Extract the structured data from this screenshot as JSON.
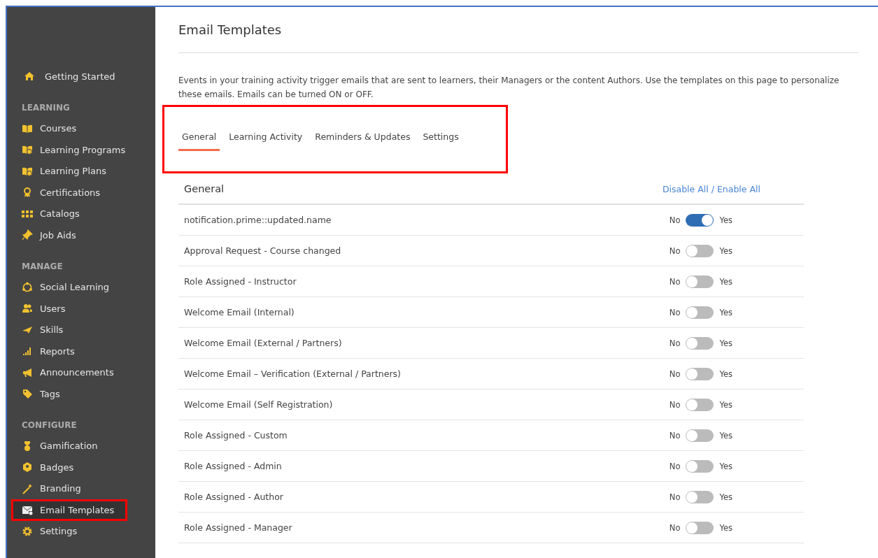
{
  "sidebar": {
    "top_items": [
      {
        "label": "Getting Started",
        "selected": false
      }
    ],
    "sections": [
      {
        "title": "LEARNING",
        "items": [
          {
            "label": "Courses",
            "selected": false
          },
          {
            "label": "Learning Programs",
            "selected": false
          },
          {
            "label": "Learning Plans",
            "selected": false
          },
          {
            "label": "Certifications",
            "selected": false
          },
          {
            "label": "Catalogs",
            "selected": false
          },
          {
            "label": "Job Aids",
            "selected": false
          }
        ]
      },
      {
        "title": "MANAGE",
        "items": [
          {
            "label": "Social Learning",
            "selected": false
          },
          {
            "label": "Users",
            "selected": false
          },
          {
            "label": "Skills",
            "selected": false
          },
          {
            "label": "Reports",
            "selected": false
          },
          {
            "label": "Announcements",
            "selected": false
          },
          {
            "label": "Tags",
            "selected": false
          }
        ]
      },
      {
        "title": "CONFIGURE",
        "items": [
          {
            "label": "Gamification",
            "selected": false
          },
          {
            "label": "Badges",
            "selected": false
          },
          {
            "label": "Branding",
            "selected": false
          },
          {
            "label": "Email Templates",
            "selected": true,
            "highlighted": true
          },
          {
            "label": "Settings",
            "selected": false
          }
        ]
      }
    ]
  },
  "page": {
    "title": "Email Templates",
    "description": "Events in your training activity trigger emails that are sent to learners, their Managers or the content Authors. Use the templates on this page to personalize these emails. Emails can be turned ON or OFF."
  },
  "tabs_highlighted": true,
  "tabs": [
    {
      "label": "General",
      "selected": true
    },
    {
      "label": "Learning Activity",
      "selected": false
    },
    {
      "label": "Reminders & Updates",
      "selected": false
    },
    {
      "label": "Settings",
      "selected": false
    }
  ],
  "table": {
    "title": "General",
    "disable_all": "Disable All",
    "separator": "/",
    "enable_all": "Enable All",
    "rows": [
      {
        "name": "notification.prime::updated.name",
        "off_label": "No",
        "on_label": "Yes",
        "on": true
      },
      {
        "name": "Approval Request - Course changed",
        "off_label": "No",
        "on_label": "Yes",
        "on": false
      },
      {
        "name": "Role Assigned - Instructor",
        "off_label": "No",
        "on_label": "Yes",
        "on": false
      },
      {
        "name": "Welcome Email (Internal)",
        "off_label": "No",
        "on_label": "Yes",
        "on": false
      },
      {
        "name": "Welcome Email (External / Partners)",
        "off_label": "No",
        "on_label": "Yes",
        "on": false
      },
      {
        "name": "Welcome Email – Verification (External / Partners)",
        "off_label": "No",
        "on_label": "Yes",
        "on": false
      },
      {
        "name": "Welcome Email (Self Registration)",
        "off_label": "No",
        "on_label": "Yes",
        "on": false
      },
      {
        "name": "Role Assigned - Custom",
        "off_label": "No",
        "on_label": "Yes",
        "on": false
      },
      {
        "name": "Role Assigned - Admin",
        "off_label": "No",
        "on_label": "Yes",
        "on": false
      },
      {
        "name": "Role Assigned - Author",
        "off_label": "No",
        "on_label": "Yes",
        "on": false
      },
      {
        "name": "Role Assigned - Manager",
        "off_label": "No",
        "on_label": "Yes",
        "on": false
      }
    ]
  }
}
